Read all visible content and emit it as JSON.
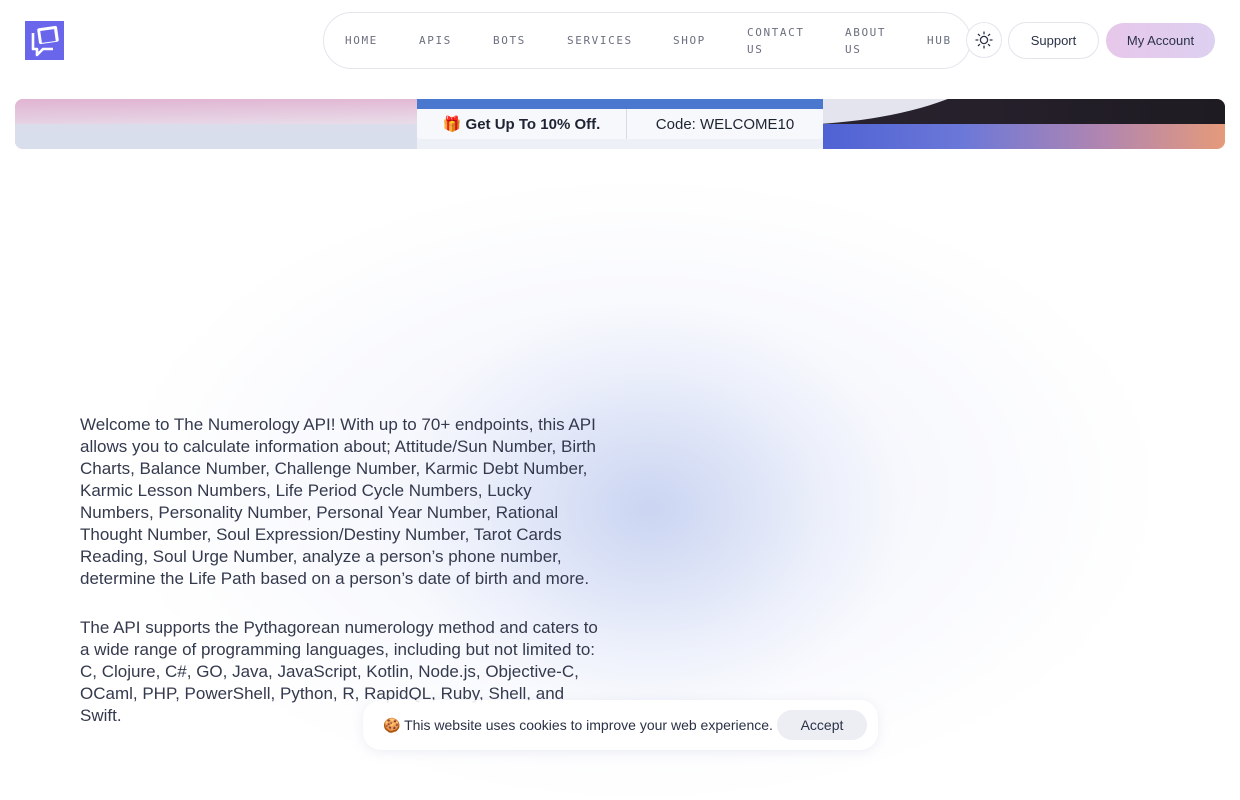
{
  "header": {
    "logo_icon": "chat-bubble-logo-icon",
    "nav": [
      {
        "label": "HOME"
      },
      {
        "label": "APIS"
      },
      {
        "label": "BOTS"
      },
      {
        "label": "SERVICES"
      },
      {
        "label": "SHOP"
      },
      {
        "label": "CONTACT US"
      },
      {
        "label": "ABOUT US"
      },
      {
        "label": "HUB"
      }
    ],
    "theme_icon": "sun-icon",
    "support_label": "Support",
    "account_label": "My Account"
  },
  "banner": {
    "offer": "🎁 Get Up To 10% Off.",
    "code": "Code: WELCOME10"
  },
  "main": {
    "paragraphs": [
      "Welcome to The Numerology API! With up to 70+ endpoints, this API allows you to calculate information about; Attitude/Sun Number, Birth Charts, Balance Number, Challenge Number, Karmic Debt Number, Karmic Lesson Numbers, Life Period Cycle Numbers, Lucky Numbers, Personality Number, Personal Year Number, Rational Thought Number, Soul Expression/Destiny Number, Tarot Cards Reading, Soul Urge Number, analyze a person’s phone number, determine the Life Path based on a person’s date of birth and more.",
      "The API supports the Pythagorean numerology method and caters to a wide range of programming languages, including but not limited to: C, Clojure, C#, GO, Java, JavaScript, Kotlin, Node.js, Objective-C, OCaml, PHP, PowerShell, Python, R, RapidQL, Ruby, Shell, and Swift."
    ]
  },
  "cookie": {
    "text": "🍪 This website uses cookies to improve your web experience.",
    "accept_label": "Accept"
  },
  "colors": {
    "account_button": "#e7c7ea",
    "banner_accent": "#4a78cf",
    "text": "#343a4d"
  }
}
